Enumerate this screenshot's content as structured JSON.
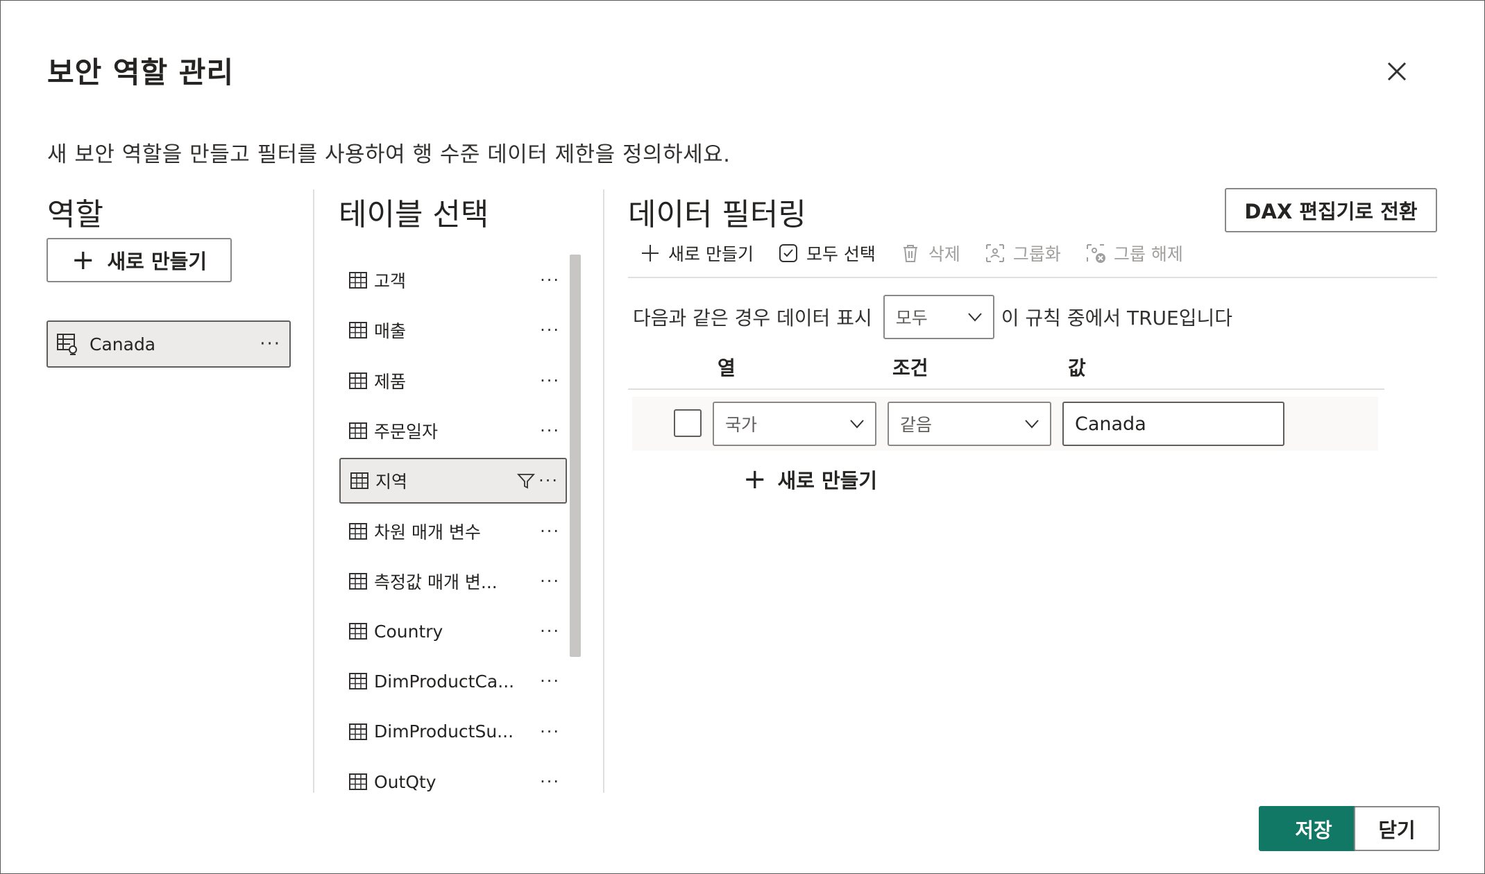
{
  "dialog": {
    "title": "보안 역할 관리",
    "description": "새 보안 역할을 만들고 필터를 사용하여 행 수준 데이터 제한을 정의하세요."
  },
  "roles": {
    "heading": "역할",
    "new_label": "새로 만들기",
    "items": [
      {
        "label": "Canada",
        "more": "···"
      }
    ]
  },
  "tables": {
    "heading": "테이블 선택",
    "items": [
      {
        "label": "고객",
        "more": "···"
      },
      {
        "label": "매출",
        "more": "···"
      },
      {
        "label": "제품",
        "more": "···"
      },
      {
        "label": "주문일자",
        "more": "···"
      },
      {
        "label": "지역",
        "more": "···"
      },
      {
        "label": "차원 매개 변수",
        "more": "···"
      },
      {
        "label": "측정값 매개 변...",
        "more": "···"
      },
      {
        "label": "Country",
        "more": "···"
      },
      {
        "label": "DimProductCa...",
        "more": "···"
      },
      {
        "label": "DimProductSu...",
        "more": "···"
      },
      {
        "label": "OutQty",
        "more": "···"
      }
    ],
    "selected_index": 4
  },
  "filter": {
    "heading": "데이터 필터링",
    "dax_button": "DAX 편집기로 전환",
    "toolbar": {
      "new": "새로 만들기",
      "select_all": "모두 선택",
      "delete": "삭제",
      "group": "그룹화",
      "ungroup": "그룹 해제"
    },
    "rule_prefix": "다음과 같은 경우 데이터 표시",
    "rule_mode": "모두",
    "rule_suffix": "이 규칙 중에서 TRUE입니다",
    "columns": {
      "column": "열",
      "condition": "조건",
      "value": "값"
    },
    "row": {
      "column": "국가",
      "condition": "같음",
      "value": "Canada",
      "checked": false
    },
    "new_rule_label": "새로 만들기"
  },
  "footer": {
    "save": "저장",
    "close": "닫기"
  },
  "colors": {
    "primary": "#117865",
    "selected_bg": "#edebe9",
    "disabled": "#a19f9d"
  }
}
